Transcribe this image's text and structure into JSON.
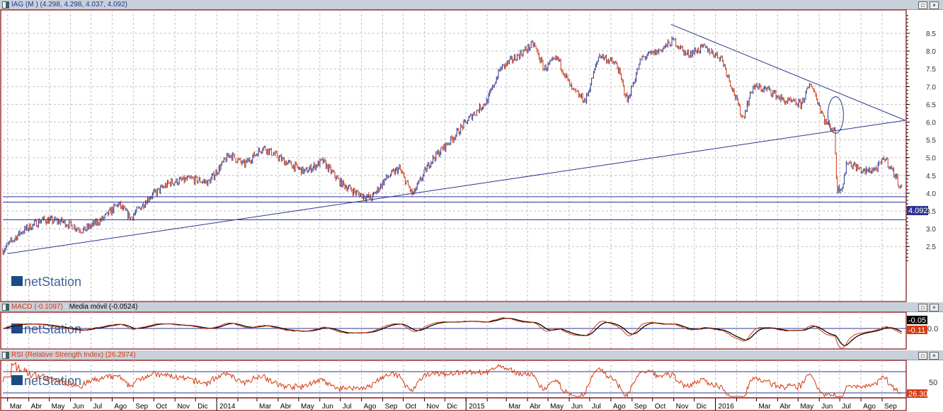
{
  "panels": {
    "main": {
      "title": "IAG (M ) (4.298, 4.298, 4.037, 4.092)",
      "last_price": "4.092"
    },
    "macd": {
      "title_macd": "MACD (-0.1097)",
      "title_sep": " - ",
      "title_ma": "Media móvil (-0.0524)",
      "signal_badge": "-0.05",
      "macd_badge": "-0.11",
      "axis_label": "0.0"
    },
    "rsi": {
      "title": "RSI (Relative Strength Index) (26.2974)",
      "badge": "26.30",
      "axis_label": "50"
    },
    "window_buttons": {
      "maximize": "□",
      "close": "×"
    },
    "watermark": "netStation"
  },
  "chart_data": {
    "type": "candlestick",
    "title": "IAG (M )",
    "y_ticks": [
      "8.5",
      "8.0",
      "7.5",
      "7.0",
      "6.5",
      "6.0",
      "5.5",
      "5.0",
      "4.5",
      "4.0",
      "3.5",
      "3.0",
      "2.5"
    ],
    "ylim": [
      2.0,
      9.1
    ],
    "x_labels": [
      "Mar",
      "Abr",
      "May",
      "Jun",
      "Jul",
      "Ago",
      "Sep",
      "Oct",
      "Nov",
      "Dic",
      "2014",
      "Mar",
      "Abr",
      "May",
      "Jun",
      "Jul",
      "Ago",
      "Sep",
      "Oct",
      "Nov",
      "Dic",
      "2015",
      "Mar",
      "Abr",
      "May",
      "Jun",
      "Jul",
      "Ago",
      "Sep",
      "Oct",
      "Nov",
      "Dic",
      "2016",
      "Mar",
      "Abr",
      "May",
      "Jun",
      "Jul",
      "Ago",
      "Sep"
    ],
    "x_range": [
      "2013-02-22",
      "2016-09-30"
    ],
    "ohlc_last": {
      "open": 4.298,
      "high": 4.298,
      "low": 4.037,
      "close": 4.092
    },
    "price_path": [
      [
        "2013-02-22",
        2.4
      ],
      [
        "2013-03-20",
        2.9
      ],
      [
        "2013-04-20",
        3.25
      ],
      [
        "2013-05-20",
        3.2
      ],
      [
        "2013-06-20",
        2.95
      ],
      [
        "2013-07-20",
        3.3
      ],
      [
        "2013-08-10",
        3.7
      ],
      [
        "2013-08-28",
        3.3
      ],
      [
        "2013-09-25",
        3.9
      ],
      [
        "2013-10-25",
        4.3
      ],
      [
        "2013-11-25",
        4.4
      ],
      [
        "2013-12-20",
        4.3
      ],
      [
        "2014-01-20",
        5.1
      ],
      [
        "2014-02-10",
        4.8
      ],
      [
        "2014-03-10",
        5.3
      ],
      [
        "2014-04-10",
        4.9
      ],
      [
        "2014-05-10",
        4.6
      ],
      [
        "2014-06-05",
        4.9
      ],
      [
        "2014-07-01",
        4.3
      ],
      [
        "2014-07-25",
        4.0
      ],
      [
        "2014-08-15",
        3.85
      ],
      [
        "2014-09-05",
        4.4
      ],
      [
        "2014-09-25",
        4.7
      ],
      [
        "2014-10-15",
        3.95
      ],
      [
        "2014-11-10",
        4.9
      ],
      [
        "2014-12-10",
        5.5
      ],
      [
        "2015-01-10",
        6.2
      ],
      [
        "2015-02-01",
        6.6
      ],
      [
        "2015-02-20",
        7.5
      ],
      [
        "2015-03-20",
        7.9
      ],
      [
        "2015-04-10",
        8.2
      ],
      [
        "2015-04-25",
        7.5
      ],
      [
        "2015-05-15",
        7.8
      ],
      [
        "2015-06-05",
        6.9
      ],
      [
        "2015-06-25",
        6.6
      ],
      [
        "2015-07-15",
        7.9
      ],
      [
        "2015-08-10",
        7.6
      ],
      [
        "2015-08-25",
        6.6
      ],
      [
        "2015-09-15",
        7.8
      ],
      [
        "2015-10-10",
        8.0
      ],
      [
        "2015-11-01",
        8.3
      ],
      [
        "2015-11-20",
        7.9
      ],
      [
        "2015-12-15",
        8.1
      ],
      [
        "2016-01-10",
        7.8
      ],
      [
        "2016-01-25",
        7.0
      ],
      [
        "2016-02-10",
        6.1
      ],
      [
        "2016-02-25",
        7.0
      ],
      [
        "2016-03-20",
        6.9
      ],
      [
        "2016-04-10",
        6.6
      ],
      [
        "2016-05-05",
        6.5
      ],
      [
        "2016-05-20",
        7.1
      ],
      [
        "2016-06-10",
        6.0
      ],
      [
        "2016-06-23",
        5.8
      ],
      [
        "2016-06-27",
        4.1
      ],
      [
        "2016-07-05",
        4.2
      ],
      [
        "2016-07-12",
        4.9
      ],
      [
        "2016-08-05",
        4.6
      ],
      [
        "2016-08-25",
        4.7
      ],
      [
        "2016-09-05",
        5.0
      ],
      [
        "2016-09-20",
        4.5
      ],
      [
        "2016-09-30",
        4.09
      ]
    ],
    "trend_lines": [
      {
        "from": [
          "2013-03-01",
          2.3
        ],
        "to": [
          "2016-10-05",
          6.05
        ]
      },
      {
        "from": [
          "2015-10-28",
          8.75
        ],
        "to": [
          "2016-10-05",
          6.05
        ]
      }
    ],
    "horizontal_lines": [
      3.9,
      3.75,
      3.25
    ],
    "ellipse": {
      "center": [
        "2016-06-25",
        6.2
      ],
      "span_days": 12,
      "span_price": 0.95
    },
    "colors": {
      "up": "#2b3590",
      "down": "#cc3a12",
      "lines": "#2b3590",
      "grid": "#c0c0c0",
      "frame": "#9a3a3a",
      "macd": "#d83a10",
      "signal": "#000000",
      "rsi": "#d83a10"
    }
  }
}
